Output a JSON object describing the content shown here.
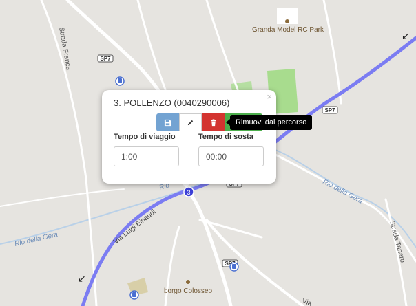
{
  "map": {
    "labels": {
      "strada_franca": "Strada Franca",
      "poi_granda": "Granda Model RC Park",
      "sp7_a": "SP7",
      "sp7_b": "SP7",
      "sp7_c": "SP7",
      "sp7_d": "SP7",
      "rio_della_gera_left": "Rio della Gera",
      "rio_della_gera_right": "Rio della Gera",
      "rio_under": "Rio",
      "via_luigi_einaudi": "Via Luigi Einaudi",
      "strada_tanaro": "Strada Tanaro",
      "borgo_colosseo": "borgo Colosseo",
      "via_bottom": "Via"
    },
    "route_marker_number": "3",
    "colors": {
      "route": "#7b7cf2",
      "park": "#a8dc8e",
      "road": "#ffffff",
      "water": "#b8d0e8",
      "background": "#e6e4e0",
      "poi_brown": "#8a6a3a"
    }
  },
  "popup": {
    "title": "3. POLLENZO (0040290006)",
    "close_glyph": "×",
    "travel_time_label": "Tempo di viaggio",
    "travel_time_value": "1:00",
    "stop_time_label": "Tempo di sosta",
    "stop_time_value": "00:00",
    "buttons": {
      "save_icon": "floppy-disk-icon",
      "edit_icon": "pencil-icon",
      "delete_icon": "trash-icon",
      "colors": {
        "save": "#73a3d2",
        "delete": "#d33430",
        "extra": "#4cae4c"
      }
    },
    "tooltip": "Rimuovi dal percorso"
  }
}
